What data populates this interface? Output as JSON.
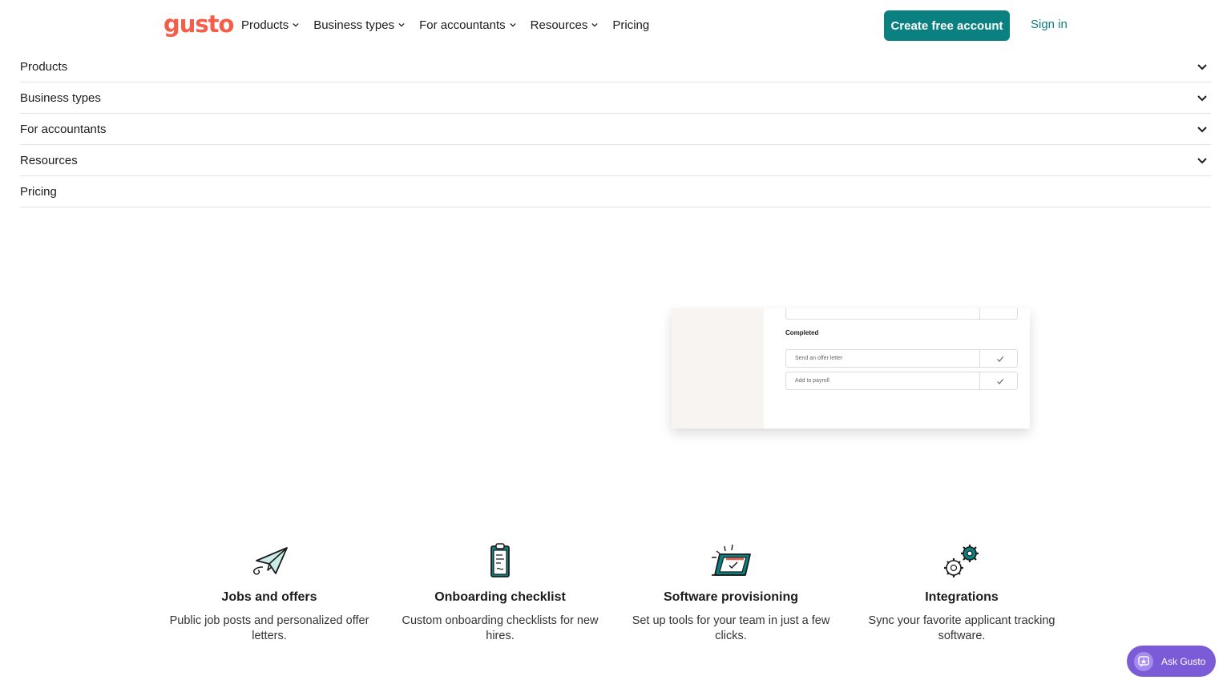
{
  "header": {
    "logo": "gusto",
    "nav": [
      "Products",
      "Business types",
      "For accountants",
      "Resources",
      "Pricing"
    ],
    "create_account": "Create free account",
    "sign_in": "Sign in"
  },
  "accordion": [
    "Products",
    "Business types",
    "For accountants",
    "Resources",
    "Pricing"
  ],
  "mockup": {
    "heading": "Completed",
    "tasks": [
      "Send an offer letter",
      "Add to payroll"
    ]
  },
  "features": [
    {
      "icon": "paper-plane-icon",
      "title": "Jobs and offers",
      "desc": "Public job posts and personalized offer letters."
    },
    {
      "icon": "clipboard-icon",
      "title": "Onboarding checklist",
      "desc": "Custom onboarding checklists for new hires."
    },
    {
      "icon": "laptop-icon",
      "title": "Software provisioning",
      "desc": "Set up tools for your team in just a few clicks."
    },
    {
      "icon": "gears-icon",
      "title": "Integrations",
      "desc": "Sync your favorite applicant tracking software."
    }
  ],
  "ask_gusto": "Ask Gusto",
  "colors": {
    "brand": "#f45d48",
    "accent": "#0a8080",
    "ask": "#7b5cd6"
  }
}
